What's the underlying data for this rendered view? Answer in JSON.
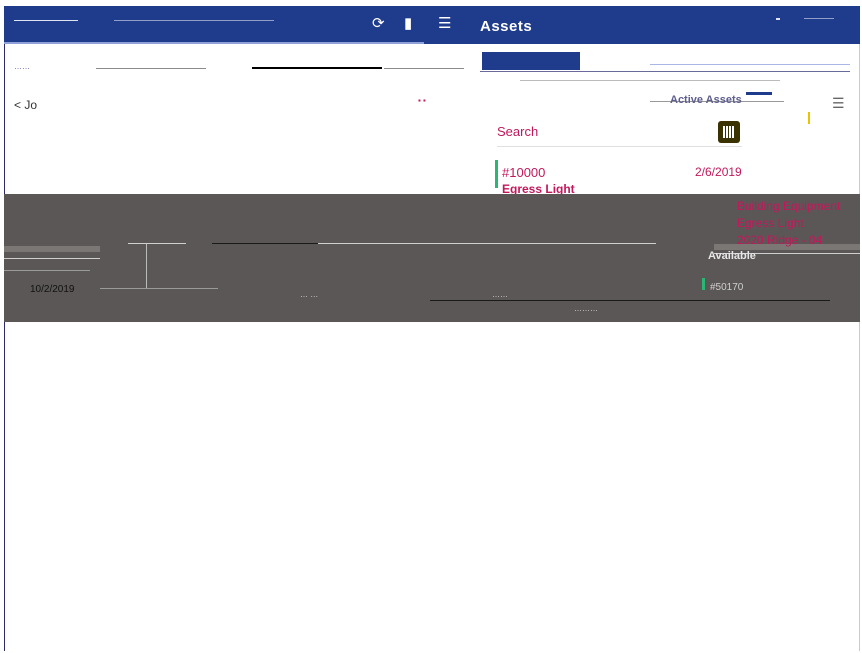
{
  "header": {
    "title": "Assets",
    "icons": [
      "sync-icon",
      "bell-icon",
      "menu-icon"
    ]
  },
  "list": {
    "title": "Active Assets",
    "search_placeholder": "Search",
    "items": [
      {
        "id": "#10000",
        "date": "2/6/2019",
        "name": "Egress Light",
        "category": "Building Equipment",
        "type": "Egress Light",
        "location": "2020 Ridge - 04",
        "status_color": "#2bb673"
      }
    ],
    "second_item": {
      "status": "Available",
      "id": "#50170"
    }
  },
  "left": {
    "label": "< Jo",
    "date": "10/2/2019"
  },
  "colors": {
    "brand": "#1f3b8c",
    "accent_text": "#c2185b",
    "status_ok": "#2bb673",
    "overlay": "#5b5756"
  }
}
